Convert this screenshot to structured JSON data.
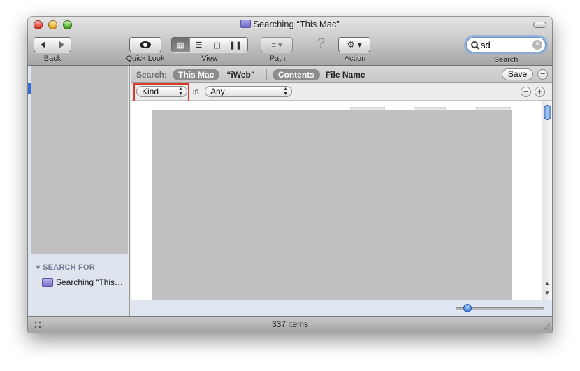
{
  "window": {
    "title": "Searching “This Mac”"
  },
  "toolbar": {
    "back_label": "Back",
    "quicklook_label": "Quick Look",
    "view_label": "View",
    "path_label": "Path",
    "action_label": "Action",
    "search_label": "Search",
    "search_value": "sd",
    "help_glyph": "?"
  },
  "sidebar": {
    "section_header": "SEARCH FOR",
    "items": [
      {
        "label": "Searching “This…"
      }
    ]
  },
  "searchbar": {
    "label": "Search:",
    "scopes": [
      {
        "label": "This Mac",
        "selected": true
      },
      {
        "label": "“iWeb”",
        "selected": false
      }
    ],
    "attributes": [
      {
        "label": "Contents",
        "selected": true
      },
      {
        "label": "File Name",
        "selected": false
      }
    ],
    "save_label": "Save",
    "remove_glyph": "−"
  },
  "criteria": {
    "attribute": "Kind",
    "operator": "is",
    "value": "Any",
    "remove_glyph": "−",
    "add_glyph": "+"
  },
  "status": {
    "item_count": "337 items"
  },
  "colors": {
    "accent": "#2f6fd8",
    "highlight_box": "#d93a2e",
    "selected_pill": "#8c8c8c"
  }
}
